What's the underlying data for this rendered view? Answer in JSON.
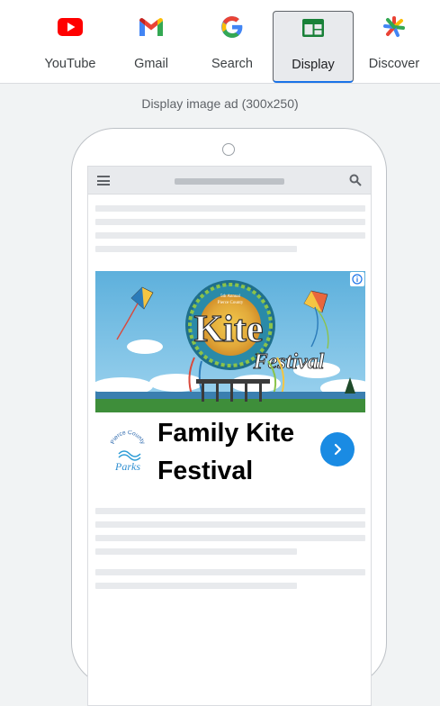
{
  "tabs": [
    {
      "label": "YouTube",
      "icon": "youtube-icon",
      "selected": false
    },
    {
      "label": "Gmail",
      "icon": "gmail-icon",
      "selected": false
    },
    {
      "label": "Search",
      "icon": "google-g-icon",
      "selected": false
    },
    {
      "label": "Display",
      "icon": "display-icon",
      "selected": true
    },
    {
      "label": "Discover",
      "icon": "discover-icon",
      "selected": false
    }
  ],
  "preview": {
    "caption": "Display image ad (300x250)"
  },
  "ad": {
    "image": {
      "subtitle_lines": [
        "5th Annual",
        "Pierce County"
      ],
      "title_word1": "Kite",
      "title_word2": "Festival"
    },
    "logo": {
      "top_text": "Pierce County",
      "script_text": "Parks"
    },
    "headline": "Family Kite Festival",
    "adchoices_icon": "info-icon",
    "cta_icon": "chevron-right-icon"
  },
  "colors": {
    "accent": "#1a73e8",
    "cta": "#1a8be3",
    "skeleton": "#e8eaed"
  }
}
